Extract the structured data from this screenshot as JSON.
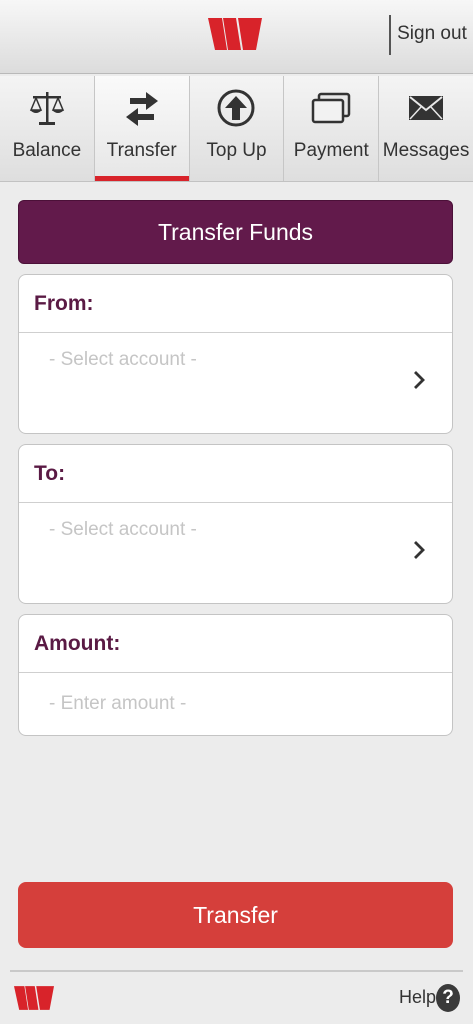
{
  "header": {
    "logo_icon": "westpac-w-logo-icon",
    "sign_out_label": "Sign out",
    "brand_color": "#d8232a"
  },
  "tabs": [
    {
      "label": "Balance",
      "icon": "scales-icon",
      "active": false
    },
    {
      "label": "Transfer",
      "icon": "transfer-arrows-icon",
      "active": true
    },
    {
      "label": "Top Up",
      "icon": "top-up-arrow-icon",
      "active": false
    },
    {
      "label": "Payment",
      "icon": "cards-icon",
      "active": false
    },
    {
      "label": "Messages",
      "icon": "envelope-icon",
      "active": false
    }
  ],
  "main": {
    "title": "Transfer Funds",
    "title_color": "#621a4b",
    "from": {
      "label": "From:",
      "placeholder": "- Select account -"
    },
    "to": {
      "label": "To:",
      "placeholder": "- Select account -"
    },
    "amount": {
      "label": "Amount:",
      "placeholder": "- Enter amount -"
    },
    "submit_label": "Transfer",
    "submit_color": "#d53f3b"
  },
  "footer": {
    "help_label": "Help",
    "help_icon_glyph": "?"
  }
}
